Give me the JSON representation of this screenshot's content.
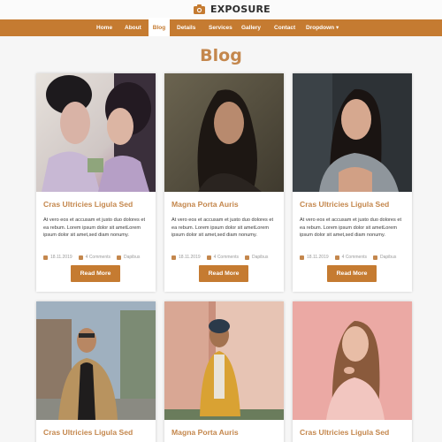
{
  "brand": {
    "name": "EXPOSURE",
    "icon": "camera-icon"
  },
  "nav": {
    "items": [
      {
        "label": "Home"
      },
      {
        "label": "About"
      },
      {
        "label": "Blog"
      },
      {
        "label": "Details"
      },
      {
        "label": "Services"
      },
      {
        "label": "Gallery"
      },
      {
        "label": "Contact"
      },
      {
        "label": "Dropdown ▾"
      }
    ],
    "active": "Blog"
  },
  "page": {
    "title": "Blog"
  },
  "posts": [
    {
      "title": "Cras Ultricies Ligula Sed",
      "excerpt": "At vero eos et accusam et justo duo dolores et ea rebum. Lorem ipsum dolor sit ametLorem ipsum dolor sit amet,sed diam nonumy.",
      "date": "18.11.2019",
      "comments": "4 Comments",
      "author": "Dapibus",
      "button": "Read More"
    },
    {
      "title": "Magna Porta Auris",
      "excerpt": "At vero eos et accusam et justo duo dolores et ea rebum. Lorem ipsum dolor sit ametLorem ipsum dolor sit amet,sed diam nonumy.",
      "date": "18.11.2019",
      "comments": "4 Comments",
      "author": "Dapibus",
      "button": "Read More"
    },
    {
      "title": "Cras Ultricies Ligula Sed",
      "excerpt": "At vero eos et accusam et justo duo dolores et ea rebum. Lorem ipsum dolor sit ametLorem ipsum dolor sit amet,sed diam nonumy.",
      "date": "18.11.2019",
      "comments": "4 Comments",
      "author": "Dapibus",
      "button": "Read More"
    },
    {
      "title": "Cras Ultricies Ligula Sed"
    },
    {
      "title": "Magna Porta Auris"
    },
    {
      "title": "Cras Ultricies Ligula Sed"
    }
  ],
  "colors": {
    "accent": "#c57b31",
    "heading": "#c4874d",
    "background": "#f6f6f6"
  }
}
